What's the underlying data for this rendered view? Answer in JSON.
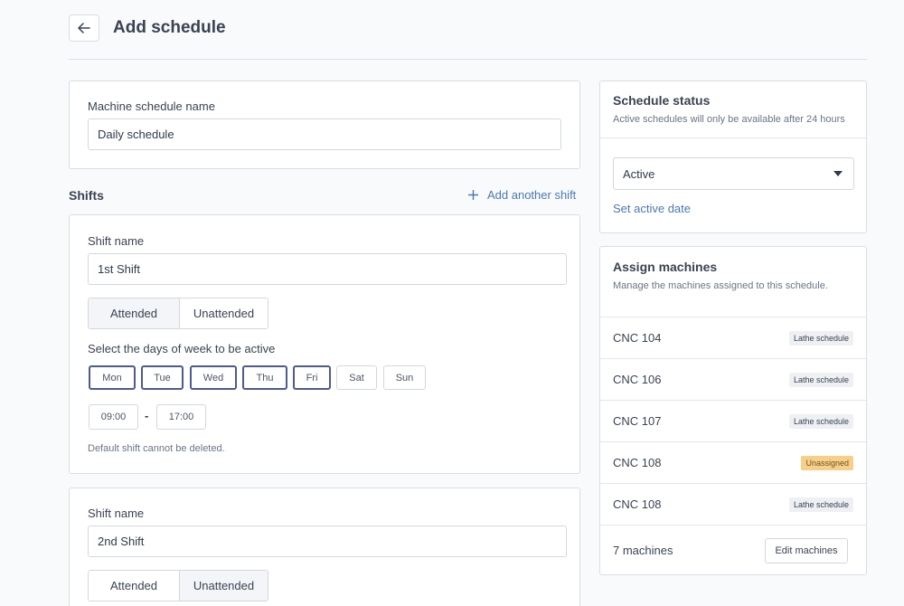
{
  "header": {
    "title": "Add schedule",
    "back_icon": "arrow-left-icon"
  },
  "schedule_name": {
    "label": "Machine schedule name",
    "value": "Daily schedule"
  },
  "shifts": {
    "title": "Shifts",
    "add_label": "Add another shift",
    "items": [
      {
        "label": "Shift name",
        "value": "1st Shift",
        "modes": [
          "Attended",
          "Unattended"
        ],
        "selected_mode": "Attended",
        "days_label": "Select the days of week to be active",
        "days": [
          "Mon",
          "Tue",
          "Wed",
          "Thu",
          "Fri",
          "Sat",
          "Sun"
        ],
        "selected_days": [
          "Mon",
          "Tue",
          "Wed",
          "Thu",
          "Fri"
        ],
        "start": "09:00",
        "separator": "-",
        "end": "17:00",
        "note": "Default shift cannot be deleted."
      },
      {
        "label": "Shift name",
        "value": "2nd Shift",
        "modes": [
          "Attended",
          "Unattended"
        ],
        "selected_mode": "Unattended"
      }
    ]
  },
  "status": {
    "title": "Schedule status",
    "subtitle": "Active schedules will only be available after 24 hours",
    "value": "Active",
    "link": "Set active date"
  },
  "assign": {
    "title": "Assign machines",
    "subtitle": "Manage the machines assigned to this schedule.",
    "machines": [
      {
        "name": "CNC 104",
        "tag": "Lathe schedule",
        "warn": false
      },
      {
        "name": "CNC 106",
        "tag": "Lathe schedule",
        "warn": false
      },
      {
        "name": "CNC 107",
        "tag": "Lathe schedule",
        "warn": false
      },
      {
        "name": "CNC 108",
        "tag": "Unassigned",
        "warn": true
      },
      {
        "name": "CNC 108",
        "tag": "Lathe schedule",
        "warn": false
      }
    ],
    "count": "7 machines",
    "edit_label": "Edit machines"
  },
  "colors": {
    "accent": "#4a7ab0",
    "selected_border": "#4d5b8e",
    "warning": "#f7cf86"
  }
}
